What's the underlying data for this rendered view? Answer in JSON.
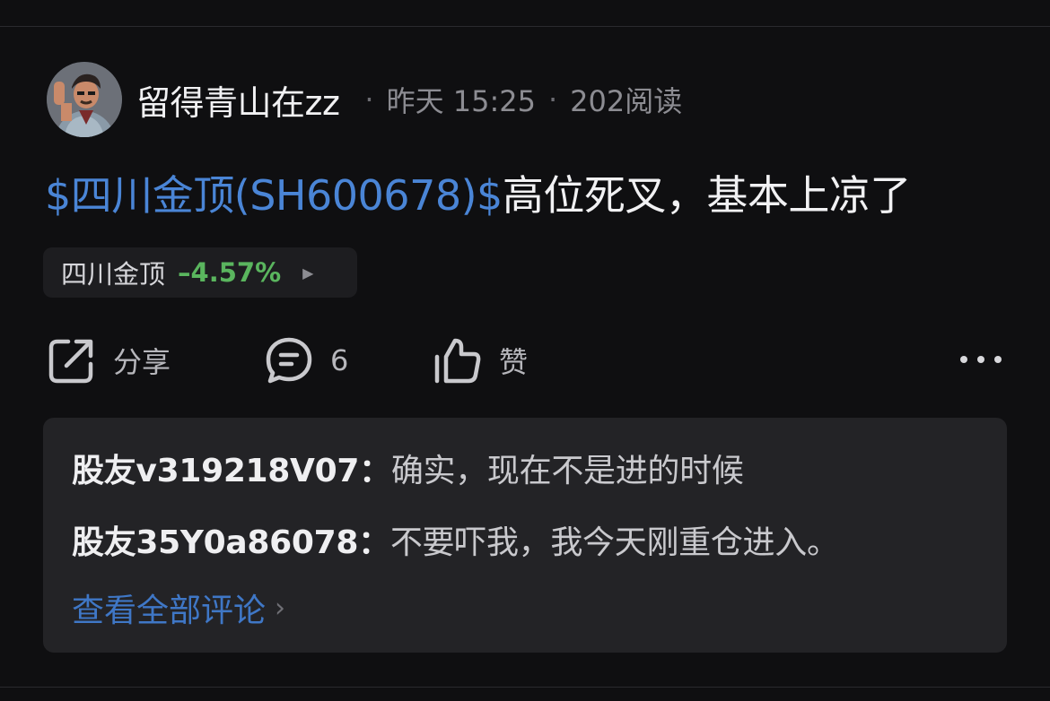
{
  "post": {
    "author": "留得青山在zz",
    "time": "昨天 15:25",
    "reads": "202阅读",
    "separator": "·",
    "stock_link": "$四川金顶(SH600678)$",
    "title_text": "高位死叉，基本上凉了"
  },
  "stock_chip": {
    "name": "四川金顶",
    "change": "–4.57%",
    "change_color": "#5ab55e",
    "arrow_icon": "triangle-right-icon"
  },
  "actions": {
    "share_label": "分享",
    "comment_count": "6",
    "like_label": "赞",
    "icons": [
      "share-icon",
      "comment-icon",
      "thumbs-up-icon",
      "more-icon"
    ]
  },
  "comments": [
    {
      "user": "股友v319218V07：",
      "text": "确实，现在不是进的时候"
    },
    {
      "user": "股友35Y0a86078：",
      "text": "不要吓我，我今天刚重仓进入。"
    }
  ],
  "view_all_label": "查看全部评论",
  "colors": {
    "link_blue": "#4a85d6",
    "background": "#0f0f11",
    "card": "#232326"
  }
}
